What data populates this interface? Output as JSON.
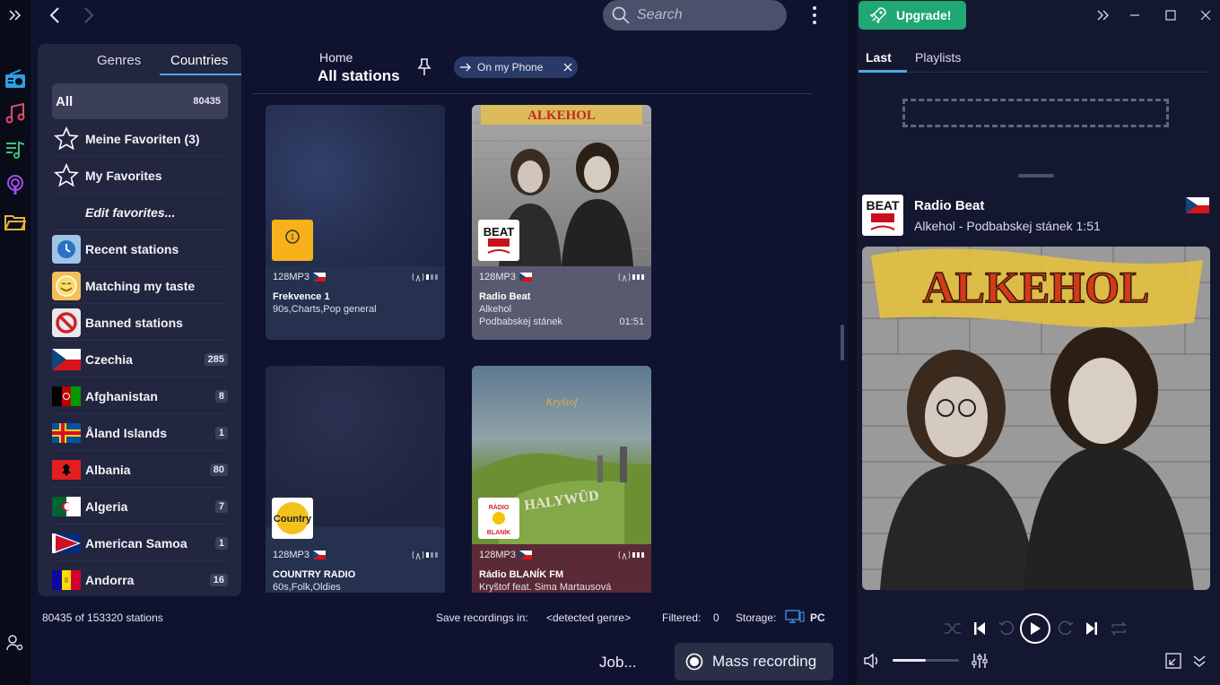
{
  "nav": {
    "search_placeholder": "Search"
  },
  "sidebar": {
    "tabs": [
      "Genres",
      "Countries"
    ],
    "active_tab": "Countries",
    "all": {
      "label": "All",
      "count": "80435"
    },
    "items": [
      {
        "label": "Meine Favoriten (3)",
        "icon": "star-icon"
      },
      {
        "label": "My Favorites",
        "icon": "star-icon"
      },
      {
        "label": "Edit favorites...",
        "icon": ""
      },
      {
        "label": "Recent stations",
        "icon": "clock-icon"
      },
      {
        "label": "Matching my taste",
        "icon": "smiley-icon"
      },
      {
        "label": "Banned stations",
        "icon": "ban-icon"
      }
    ],
    "countries": [
      {
        "label": "Czechia",
        "count": "285"
      },
      {
        "label": "Afghanistan",
        "count": "8"
      },
      {
        "label": "Åland Islands",
        "count": "1"
      },
      {
        "label": "Albania",
        "count": "80"
      },
      {
        "label": "Algeria",
        "count": "7"
      },
      {
        "label": "American Samoa",
        "count": "1"
      },
      {
        "label": "Andorra",
        "count": "16"
      }
    ]
  },
  "header": {
    "home": "Home",
    "title": "All stations",
    "filter_chip": "On my Phone"
  },
  "stations": [
    {
      "quality": "128MP3",
      "name": "Frekvence 1",
      "line2": "90s,Charts,Pop general",
      "line3": "",
      "time": "",
      "logo_text": "Frekvence"
    },
    {
      "quality": "128MP3",
      "name": "Radio Beat",
      "line2": "Alkehol",
      "line3": "Podbabskej stánek",
      "time": "01:51",
      "logo_text": "BEAT"
    },
    {
      "quality": "128MP3",
      "name": "COUNTRY RADIO",
      "line2": "60s,Folk,Oldies",
      "line3": "",
      "time": "",
      "logo_text": "Country"
    },
    {
      "quality": "128MP3",
      "name": "Rádio BLANÍK FM",
      "line2": "Kryštof feat. Sima Martausová",
      "line3": "",
      "time": "",
      "logo_text": "BLANÍK"
    }
  ],
  "status": {
    "count_text": "80435 of 153320 stations",
    "save_label": "Save recordings in:",
    "save_value": "<detected genre>",
    "filtered_label": "Filtered:",
    "filtered_value": "0",
    "storage_label": "Storage:",
    "storage_value": "PC"
  },
  "actions": {
    "job": "Job...",
    "mass_recording": "Mass recording"
  },
  "right": {
    "upgrade": "Upgrade!",
    "tabs": [
      "Last",
      "Playlists"
    ],
    "active_tab": "Last",
    "now_playing": {
      "station": "Radio Beat",
      "track": "Alkehol  -  Podbabskej stánek 1:51"
    },
    "cover_text": "ALKEHOL",
    "volume": 0.5
  },
  "colors": {
    "accent": "#4ea8e6",
    "upgrade": "#1fa774",
    "panel": "#22263f"
  }
}
